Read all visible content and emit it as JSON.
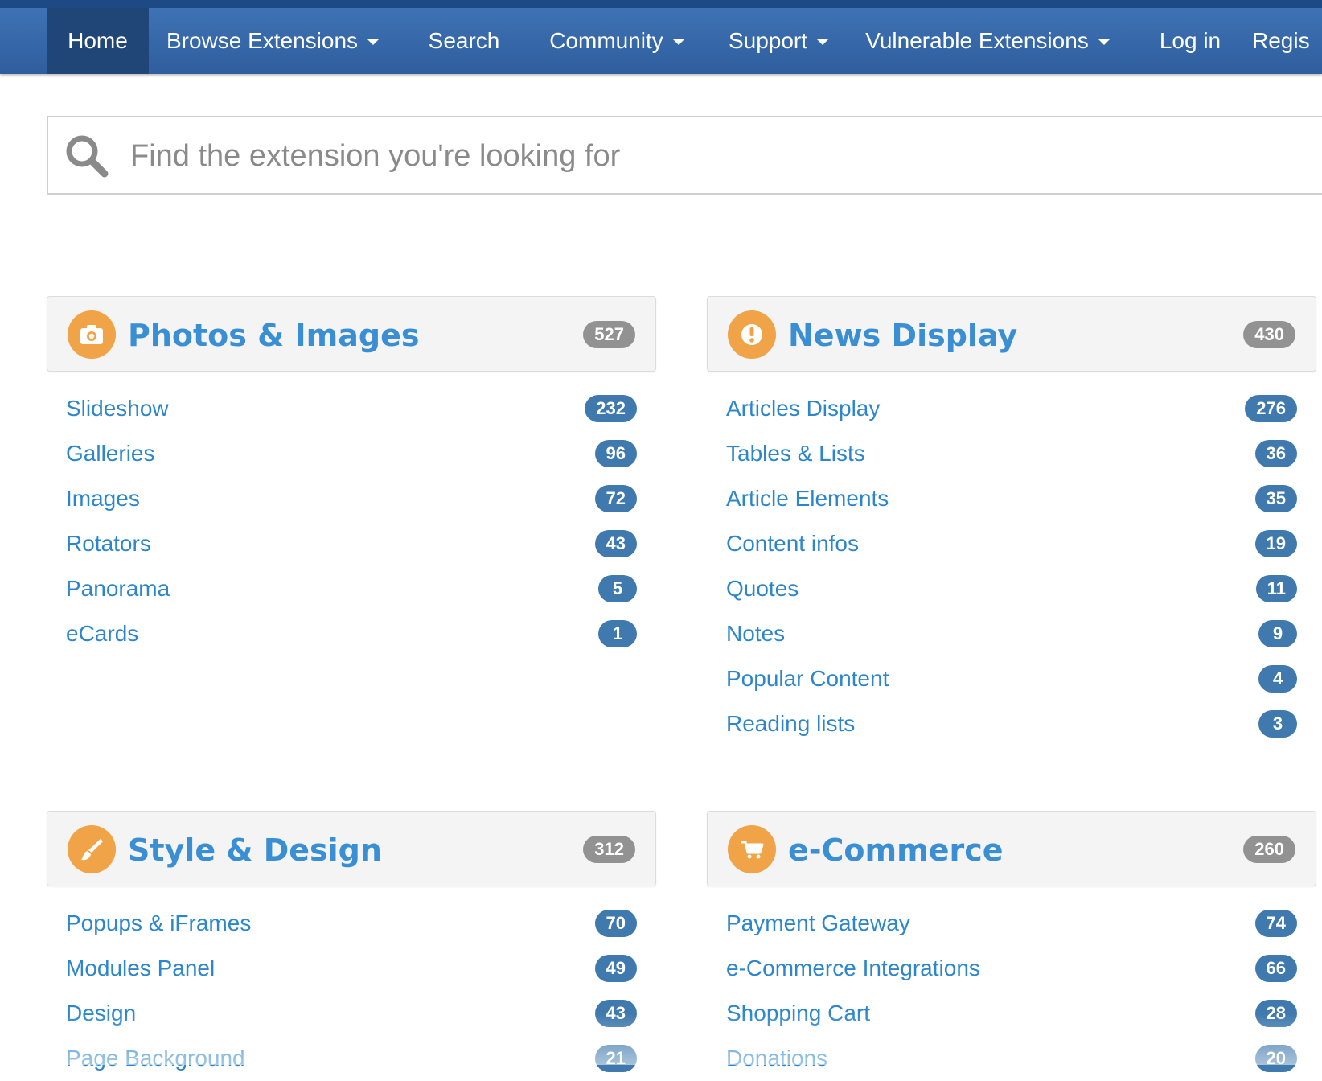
{
  "nav": {
    "home": "Home",
    "browse": "Browse Extensions",
    "search": "Search",
    "community": "Community",
    "support": "Support",
    "vulnerable": "Vulnerable Extensions",
    "login": "Log in",
    "register": "Regis"
  },
  "search": {
    "placeholder": "Find the extension you're looking for"
  },
  "categories": [
    {
      "title": "Photos & Images",
      "total": "527",
      "icon": "camera-icon",
      "items": [
        {
          "label": "Slideshow",
          "count": "232"
        },
        {
          "label": "Galleries",
          "count": "96"
        },
        {
          "label": "Images",
          "count": "72"
        },
        {
          "label": "Rotators",
          "count": "43"
        },
        {
          "label": "Panorama",
          "count": "5"
        },
        {
          "label": "eCards",
          "count": "1"
        }
      ]
    },
    {
      "title": "News Display",
      "total": "430",
      "icon": "exclamation-icon",
      "items": [
        {
          "label": "Articles Display",
          "count": "276"
        },
        {
          "label": "Tables & Lists",
          "count": "36"
        },
        {
          "label": "Article Elements",
          "count": "35"
        },
        {
          "label": "Content infos",
          "count": "19"
        },
        {
          "label": "Quotes",
          "count": "11"
        },
        {
          "label": "Notes",
          "count": "9"
        },
        {
          "label": "Popular Content",
          "count": "4"
        },
        {
          "label": "Reading lists",
          "count": "3"
        }
      ]
    },
    {
      "title": "Style & Design",
      "total": "312",
      "icon": "paintbrush-icon",
      "items": [
        {
          "label": "Popups & iFrames",
          "count": "70"
        },
        {
          "label": "Modules Panel",
          "count": "49"
        },
        {
          "label": "Design",
          "count": "43"
        },
        {
          "label": "Page Background",
          "count": "21"
        }
      ]
    },
    {
      "title": "e-Commerce",
      "total": "260",
      "icon": "shopping-cart-icon",
      "items": [
        {
          "label": "Payment Gateway",
          "count": "74"
        },
        {
          "label": "e-Commerce Integrations",
          "count": "66"
        },
        {
          "label": "Shopping Cart",
          "count": "28"
        },
        {
          "label": "Donations",
          "count": "20"
        }
      ]
    }
  ],
  "colors": {
    "nav_bg": "#3a6cae",
    "nav_active": "#1f4677",
    "accent_orange": "#f0a447",
    "link_blue": "#2d86cc",
    "count_badge": "#3f79ad",
    "total_badge": "#929292"
  }
}
